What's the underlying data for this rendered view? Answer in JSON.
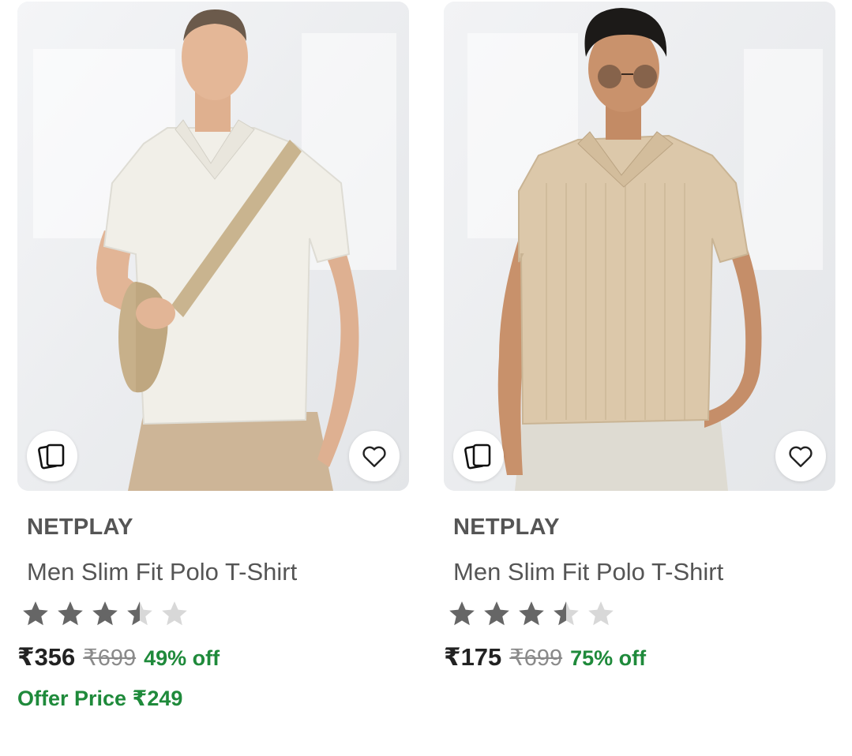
{
  "colors": {
    "brand_text": "#555555",
    "price_text": "#222222",
    "mrp_text": "#8a8a8a",
    "discount_green": "#1f8a3b",
    "star_filled": "#666666",
    "star_empty": "#d8d8d8"
  },
  "products": [
    {
      "brand": "NETPLAY",
      "title": "Men Slim Fit Polo T-Shirt",
      "rating": 3.5,
      "rating_max": 5,
      "price": "₹356",
      "mrp": "₹699",
      "discount": "49% off",
      "offer_price": "Offer Price ₹249",
      "image_alt": "Man wearing off-white textured polo t-shirt with beige crossbody bag",
      "shirt_color": "#f1efe8",
      "pants_color": "#cdb597",
      "icons": {
        "similar": "similar-products-icon",
        "wishlist": "heart-icon"
      }
    },
    {
      "brand": "NETPLAY",
      "title": "Men Slim Fit Polo T-Shirt",
      "rating": 3.5,
      "rating_max": 5,
      "price": "₹175",
      "mrp": "₹699",
      "discount": "75% off",
      "offer_price": "",
      "image_alt": "Man in sunglasses wearing beige ribbed polo t-shirt",
      "shirt_color": "#dcc8aa",
      "pants_color": "#dedbd2",
      "icons": {
        "similar": "similar-products-icon",
        "wishlist": "heart-icon"
      }
    }
  ]
}
